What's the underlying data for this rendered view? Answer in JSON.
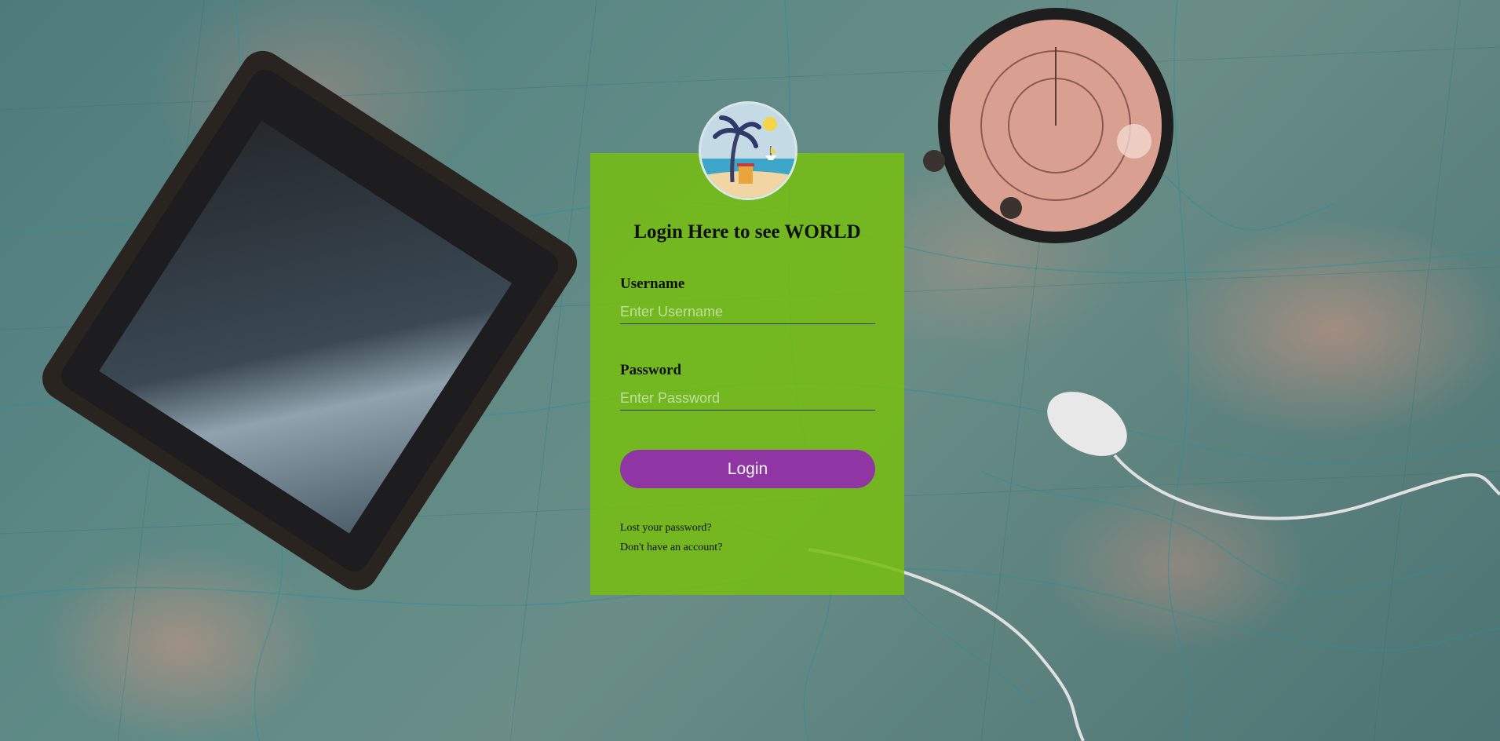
{
  "login": {
    "title": "Login Here to see WORLD",
    "username_label": "Username",
    "username_placeholder": "Enter Username",
    "username_value": "",
    "password_label": "Password",
    "password_placeholder": "Enter Password",
    "password_value": "",
    "button_label": "Login",
    "forgot_link": "Lost your password?",
    "signup_link": "Don't have an account?",
    "avatar_icon": "beach-palm-avatar-icon"
  },
  "colors": {
    "card": "#76be10",
    "button": "#8f36a4",
    "underline": "#2a3a5a"
  }
}
